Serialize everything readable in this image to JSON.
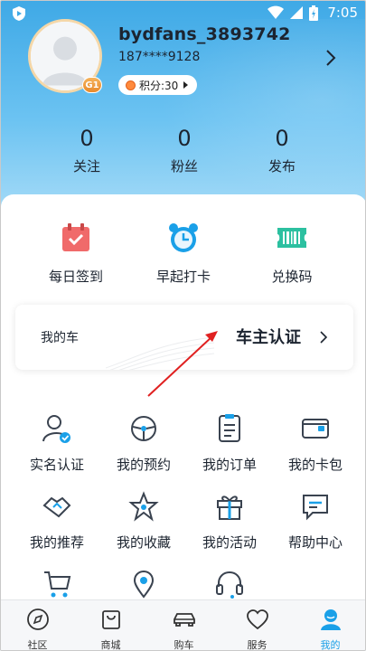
{
  "status_bar": {
    "time": "7:05"
  },
  "profile": {
    "username": "bydfans_3893742",
    "phone": "187****9128",
    "level": "G1",
    "points_label": "积分:30"
  },
  "stats": [
    {
      "value": "0",
      "label": "关注"
    },
    {
      "value": "0",
      "label": "粉丝"
    },
    {
      "value": "0",
      "label": "发布"
    }
  ],
  "quick_actions": [
    {
      "label": "每日签到",
      "icon": "calendar-check-icon"
    },
    {
      "label": "早起打卡",
      "icon": "alarm-clock-icon"
    },
    {
      "label": "兑换码",
      "icon": "ticket-barcode-icon"
    }
  ],
  "my_car": {
    "label": "我的车",
    "verify_label": "车主认证"
  },
  "services": [
    {
      "label": "实名认证",
      "icon": "user-verified-icon"
    },
    {
      "label": "我的预约",
      "icon": "steering-wheel-icon"
    },
    {
      "label": "我的订单",
      "icon": "order-list-icon"
    },
    {
      "label": "我的卡包",
      "icon": "card-wallet-icon"
    },
    {
      "label": "我的推荐",
      "icon": "handshake-icon"
    },
    {
      "label": "我的收藏",
      "icon": "star-icon"
    },
    {
      "label": "我的活动",
      "icon": "gift-icon"
    },
    {
      "label": "帮助中心",
      "icon": "chat-bubble-icon"
    },
    {
      "label": "",
      "icon": "shopping-cart-icon"
    },
    {
      "label": "",
      "icon": "location-pin-icon"
    },
    {
      "label": "",
      "icon": "headset-icon"
    }
  ],
  "tabs": [
    {
      "label": "社区",
      "icon": "compass-icon"
    },
    {
      "label": "商城",
      "icon": "shopping-bag-icon"
    },
    {
      "label": "购车",
      "icon": "car-icon"
    },
    {
      "label": "服务",
      "icon": "heart-icon"
    },
    {
      "label": "我的",
      "icon": "user-icon"
    }
  ],
  "active_tab": "我的",
  "colors": {
    "accent": "#1aa0e8",
    "header_gradient_top": "#3fa9e6",
    "annotation_arrow": "#e02020"
  }
}
